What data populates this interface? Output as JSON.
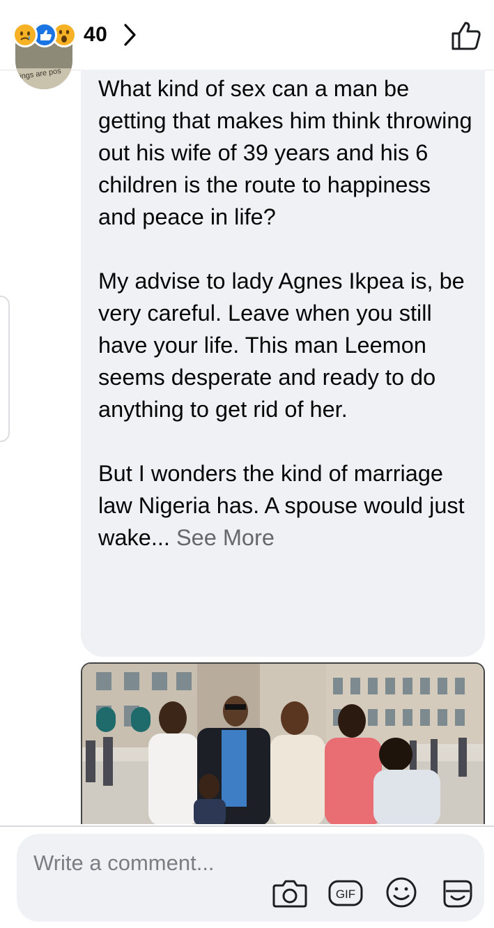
{
  "header": {
    "reaction_icons": [
      "sad-reaction-icon",
      "like-reaction-icon",
      "wow-reaction-icon"
    ],
    "reaction_count": "40",
    "chevron_icon": "chevron-right-icon",
    "like_icon": "thumbs-up-icon"
  },
  "avatar": {
    "caption": "ings are pos"
  },
  "comment": {
    "paragraph_1": "What kind of sex can a man be getting that makes him think throwing out his wife of 39 years and his 6 children is the route to happiness and peace in life?",
    "paragraph_2": "My advise to lady Agnes Ikpea is, be very careful. Leave when you still have your life. This man Leemon seems desperate and ready to do anything to get rid of her.",
    "paragraph_3": "But I wonders the kind of marriage law Nigeria has. A spouse would just wake...",
    "see_more": "See More"
  },
  "composer": {
    "placeholder": "Write a comment...",
    "icons": [
      "camera-icon",
      "gif-icon",
      "emoji-icon",
      "sticker-icon"
    ],
    "gif_label": "GIF"
  },
  "colors": {
    "bubble_bg": "#f0f1f5",
    "like_blue": "#1b74e4",
    "reaction_yellow": "#f7b125",
    "muted_text": "#65676b"
  }
}
